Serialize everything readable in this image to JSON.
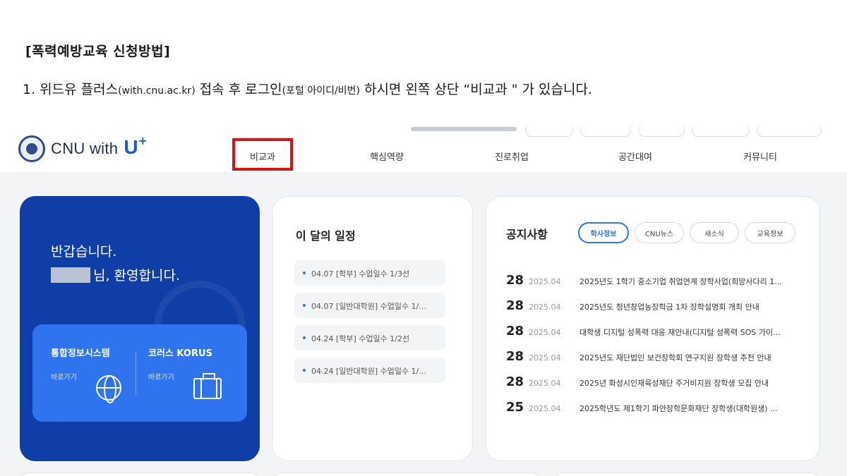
{
  "doc": {
    "heading": "[폭력예방교육 신청방법]",
    "step_prefix": "1. 위드유 플러스",
    "step_url": "(with.cnu.ac.kr)",
    "step_mid": " 접속 후 로그인",
    "step_portal": "(포털 아이디/비번)",
    "step_suffix": " 하시면 왼쪽 상단 “비교과 \" 가 있습니다."
  },
  "site": {
    "logo_text": "CNU with",
    "logo_u": "U",
    "logo_plus": "+",
    "nav": [
      "비교과",
      "핵심역량",
      "진로취업",
      "공간대여",
      "커뮤니티"
    ],
    "highlight_color": "#e01010",
    "brand_color": "#0e3ea6",
    "accent_color": "#2f74ee"
  },
  "welcome": {
    "greeting": "반갑습니다.",
    "name_suffix": "님, 환영합니다.",
    "links": [
      {
        "title": "통합정보시스템",
        "sub": "바로가기",
        "icon": "globe-icon"
      },
      {
        "title": "코러스 KORUS",
        "sub": "바로가기",
        "icon": "briefcase-icon"
      }
    ]
  },
  "schedule": {
    "title": "이 달의 일정",
    "items": [
      "04.07 [학부] 수업일수 1/3선",
      "04.07 [일반대학원] 수업일수 1/...",
      "04.24 [학부] 수업일수 1/2선",
      "04.24 [일반대학원] 수업일수 1/..."
    ]
  },
  "notice": {
    "title": "공지사항",
    "tabs": [
      "학사정보",
      "CNU뉴스",
      "새소식",
      "교육정보"
    ],
    "active_tab": "학사정보",
    "rows": [
      {
        "day": "28",
        "month": "2025.04",
        "text": "2025년도 1학기 중소기업 취업연계 장학사업(희망사다리 1..."
      },
      {
        "day": "28",
        "month": "2025.04",
        "text": "2025년도 청년창업농장학금 1차 장학설명회 개최 안내"
      },
      {
        "day": "28",
        "month": "2025.04",
        "text": "대학생 디지털 성폭력 대응 재안내(디지털 성폭력 SOS 가이..."
      },
      {
        "day": "28",
        "month": "2025.04",
        "text": "2025년도 재단법인 보건장학회 연구지원 장학생 추천 안내"
      },
      {
        "day": "28",
        "month": "2025.04",
        "text": "2025년 화성시인재육성재단 주거비지원 장학생 모집 안내"
      },
      {
        "day": "25",
        "month": "2025.04",
        "text": "2025학년도 제1학기 파안장학문화재단 장학생(대학원생) ..."
      }
    ]
  }
}
